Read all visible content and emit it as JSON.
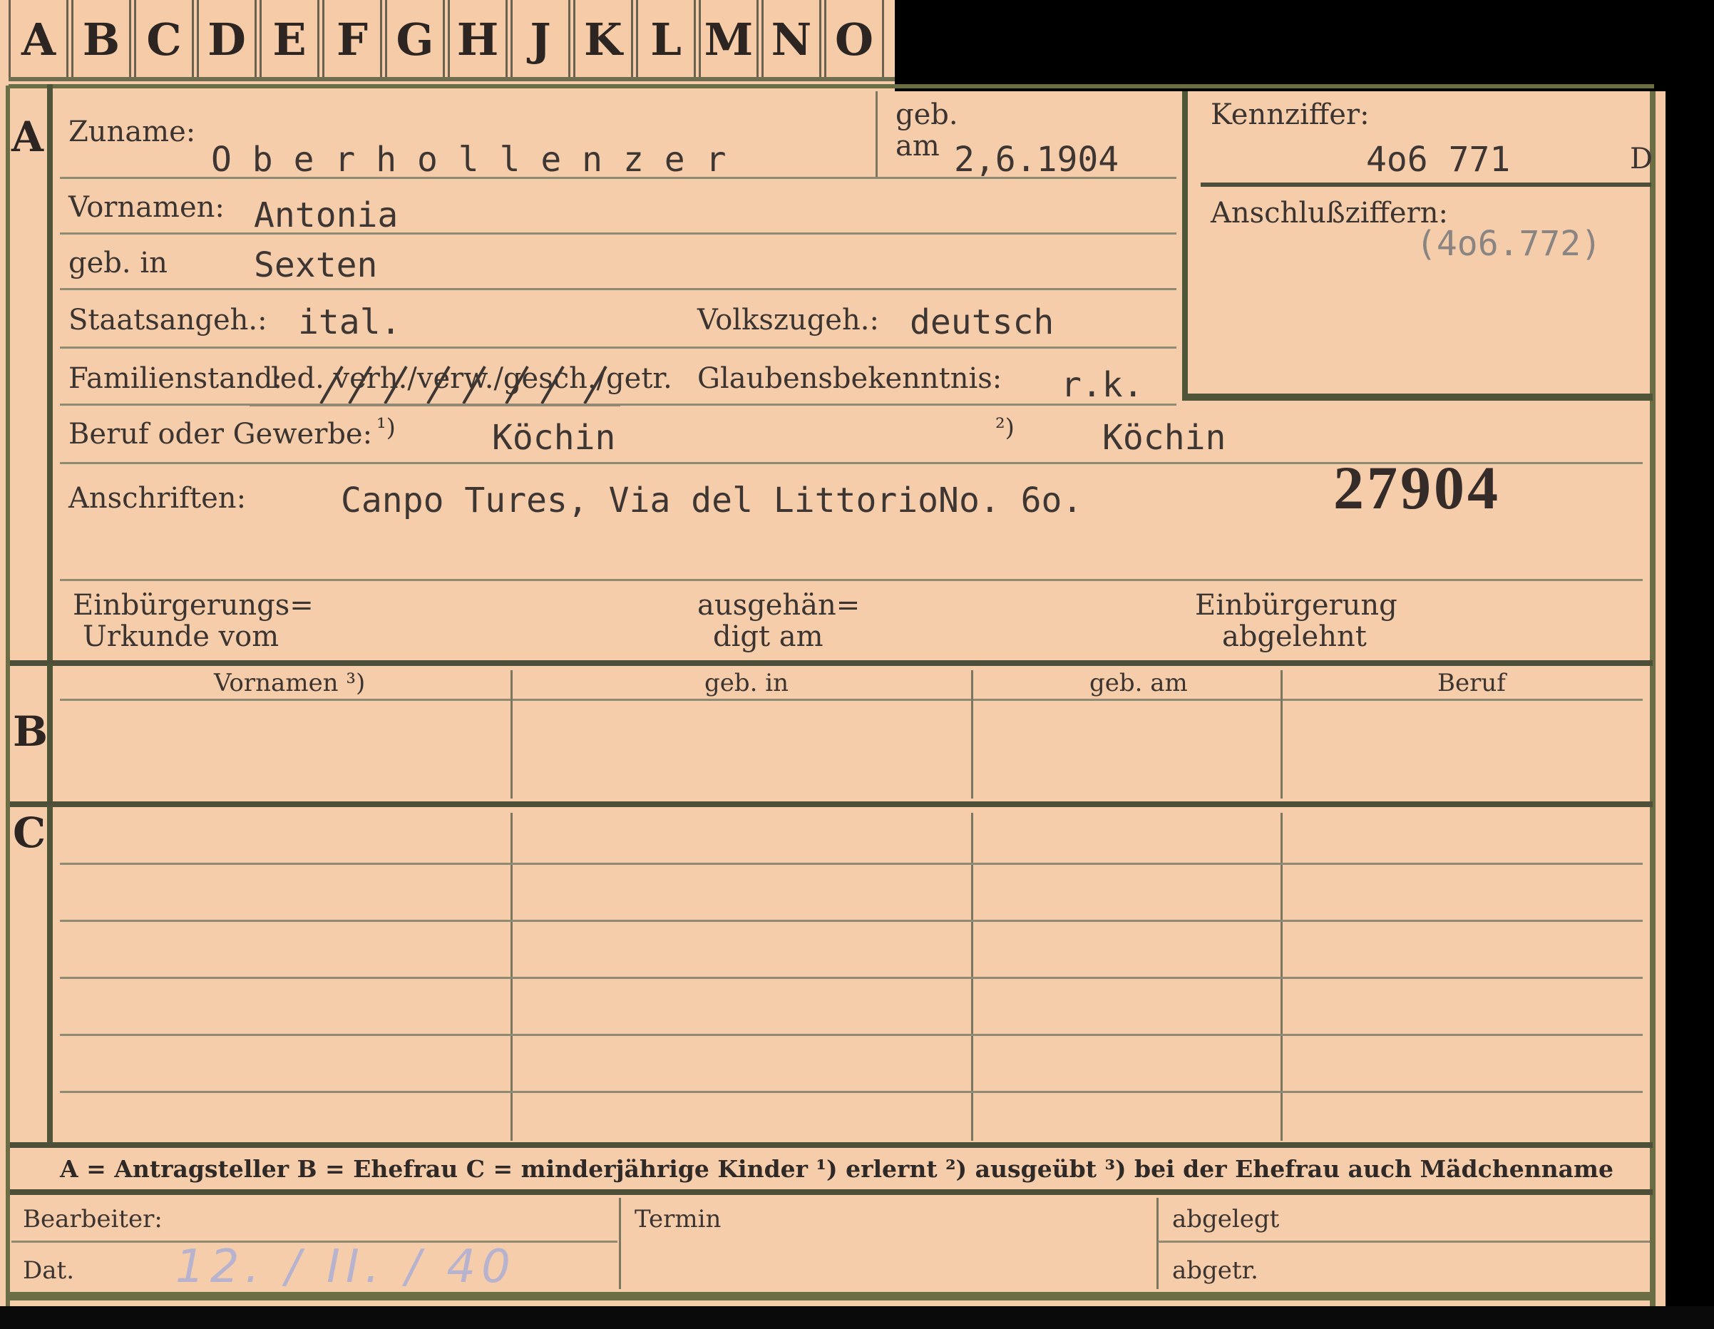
{
  "tabs": [
    "A",
    "B",
    "C",
    "D",
    "E",
    "F",
    "G",
    "H",
    "J",
    "K",
    "L",
    "M",
    "N",
    "O"
  ],
  "sections": {
    "a": "A",
    "b": "B",
    "c": "C"
  },
  "labels": {
    "zuname": "Zuname:",
    "geb_line1": "geb.",
    "geb_line2": "am",
    "vornamen": "Vornamen:",
    "geb_in": "geb. in",
    "staatsangeh": "Staatsangeh.:",
    "volkszugeh": "Volkszugeh.:",
    "familienstand": "Familienstand:",
    "familienstand_options": "led. verh./verw./gesch./getr.",
    "glaubensbekenntnis": "Glaubensbekenntnis:",
    "beruf": "Beruf oder Gewerbe:",
    "note1": "¹)",
    "note2": "²)",
    "anschriften": "Anschriften:",
    "einb_urkunde_1": "Einbürgerungs=",
    "einb_urkunde_2": "Urkunde vom",
    "ausgehaendigt_1": "ausgehän=",
    "ausgehaendigt_2": "digt am",
    "einb_abgelehnt_1": "Einbürgerung",
    "einb_abgelehnt_2": "abgelehnt",
    "kennziffer": "Kennziffer:",
    "anschlussziffern": "Anschlußziffern:"
  },
  "values": {
    "zuname": "O b e r h o l l e n z e r",
    "geb_am": "2,6.1904",
    "vornamen": "Antonia",
    "geb_in": "Sexten",
    "staatsangeh": "ital.",
    "volkszugeh": "deutsch",
    "glaubensbekenntnis": "r.k.",
    "beruf_erlernt": "Köchin",
    "beruf_ausgeuebt": "Köchin",
    "anschrift": "Canpo Tures, Via del LittorioNo. 6o.",
    "stamp_number": "27904",
    "kennziffer": "4o6 771",
    "kennziffer_suffix": "D",
    "anschlussziffern": "(4o6.772)"
  },
  "table_b": {
    "headers": [
      "Vornamen ³)",
      "geb. in",
      "geb. am",
      "Beruf"
    ]
  },
  "legend": "A = Antragsteller   B = Ehefrau   C = minderjährige Kinder   ¹) erlernt   ²) ausgeübt   ³) bei der Ehefrau auch Mädchenname",
  "footer": {
    "bearbeiter": "Bearbeiter:",
    "dat": "Dat.",
    "dat_value": "12. / II. / 40",
    "termin": "Termin",
    "abgelegt": "abgelegt",
    "abgetr": "abgetr."
  },
  "colors": {
    "card": "#f6cdaa",
    "rules": "#6b6d45",
    "ink": "#3a3230"
  }
}
